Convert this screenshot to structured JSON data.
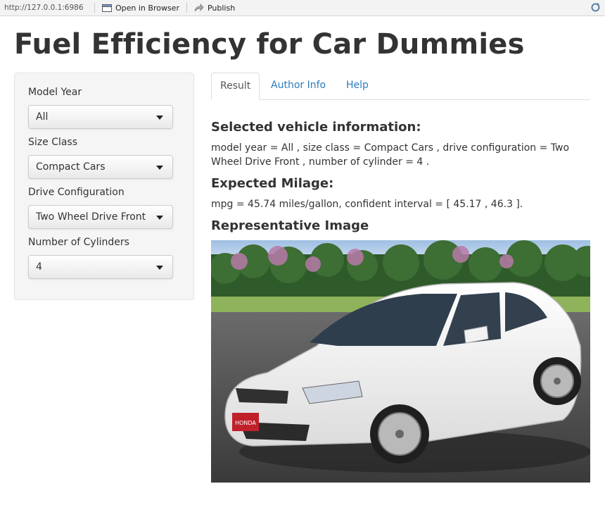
{
  "toolbar": {
    "url": "http://127.0.0.1:6986",
    "open_in_browser": "Open in Browser",
    "publish": "Publish"
  },
  "page_title": "Fuel Efficiency for Car Dummies",
  "sidebar": {
    "model_year": {
      "label": "Model Year",
      "value": "All"
    },
    "size_class": {
      "label": "Size Class",
      "value": "Compact Cars"
    },
    "drive": {
      "label": "Drive Configuration",
      "value": "Two Wheel Drive Front"
    },
    "cylinders": {
      "label": "Number of Cylinders",
      "value": "4"
    }
  },
  "tabs": [
    {
      "label": "Result",
      "active": true
    },
    {
      "label": "Author Info",
      "active": false
    },
    {
      "label": "Help",
      "active": false
    }
  ],
  "result": {
    "selected_heading": "Selected vehicle information:",
    "selected_text": "model year = All , size class = Compact Cars , drive configuration = Two Wheel Drive Front , number of cylinder = 4 .",
    "milage_heading": "Expected Milage:",
    "milage_text": "mpg = 45.74 miles/gallon, confident interval = [ 45.17 , 46.3 ].",
    "image_heading": "Representative Image",
    "image_badge": "HONDA"
  },
  "colors": {
    "tab_link": "#2a7dbd",
    "sidebar_bg": "#f5f5f5",
    "car_body": "#f7f7f7",
    "sky": "#bcd3ec",
    "grass": "#8fb35a",
    "road": "#444444"
  }
}
